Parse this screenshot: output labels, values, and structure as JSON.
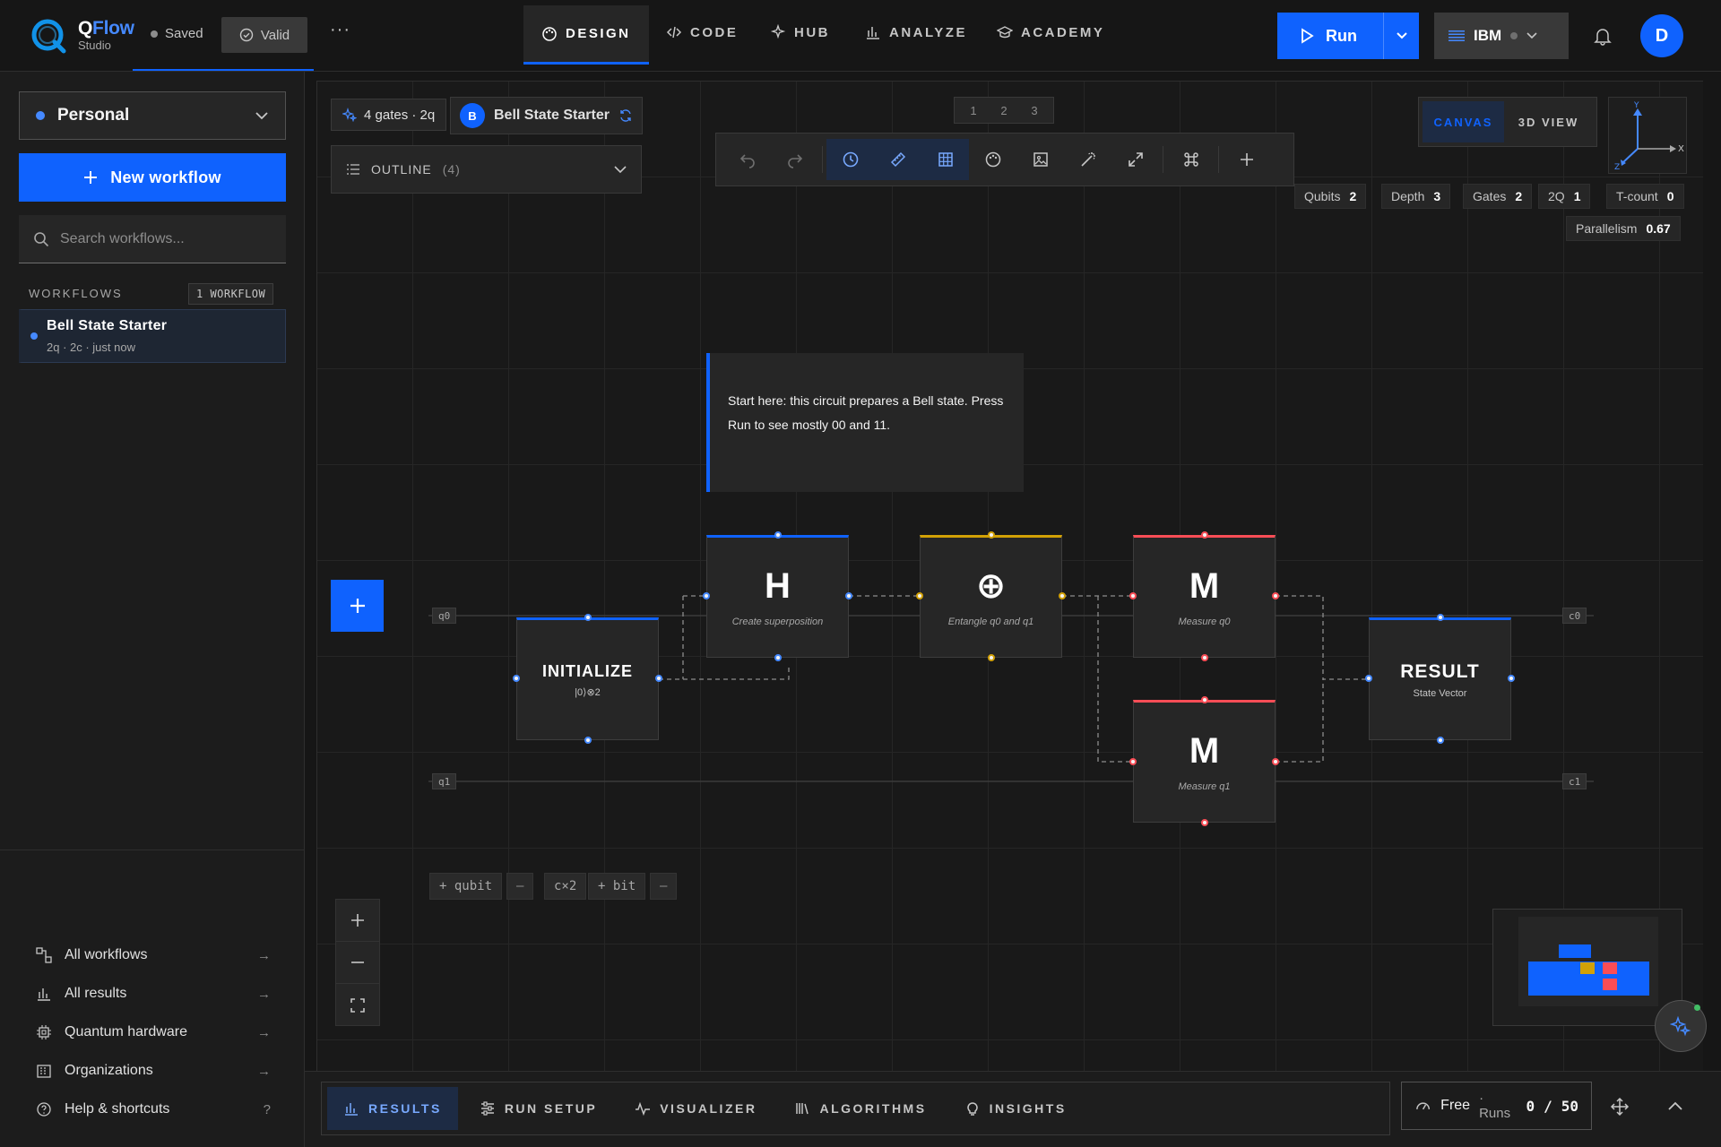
{
  "app": {
    "name_q": "Q",
    "name_rest": "Flow",
    "subtitle": "Studio",
    "saved_label": "Saved",
    "valid_label": "Valid",
    "more": "···"
  },
  "nav": [
    "DESIGN",
    "CODE",
    "HUB",
    "ANALYZE",
    "ACADEMY"
  ],
  "actions": {
    "run_label": "Run",
    "backend_label": "IBM",
    "avatar_initial": "D"
  },
  "sidebar": {
    "workspace": "Personal",
    "new_workflow": "New workflow",
    "search_placeholder": "Search workflows...",
    "workflows_heading": "WORKFLOWS",
    "workflows_count": "1 WORKFLOW",
    "workflow_item": {
      "title": "Bell State Starter",
      "meta": "2q  ·  2c  ·  just now"
    },
    "links": [
      "All workflows",
      "All results",
      "Quantum hardware",
      "Organizations",
      "Help & shortcuts"
    ],
    "help_hint": "?"
  },
  "canvas": {
    "gates_summary": "4 gates · 2q",
    "circuit_badge": "B",
    "circuit_name": "Bell State Starter",
    "outline_label": "OUTLINE",
    "outline_count": "(4)",
    "steps": [
      "1",
      "2",
      "3"
    ],
    "view_canvas": "CANVAS",
    "view_3d": "3D VIEW",
    "axis_labels": {
      "y": "Y",
      "x": "X",
      "z": "Z"
    },
    "stats": [
      {
        "label": "Qubits",
        "value": "2"
      },
      {
        "label": "Depth",
        "value": "3"
      },
      {
        "label": "Gates",
        "value": "2"
      },
      {
        "label": "2Q",
        "value": "1"
      },
      {
        "label": "T-count",
        "value": "0"
      }
    ],
    "parallelism": {
      "label": "Parallelism",
      "value": "0.67"
    },
    "note": "Start here: this circuit prepares a Bell state. Press Run to see mostly 00 and 11.",
    "wires": {
      "q0": "q0",
      "q1": "q1",
      "c0": "c0",
      "c1": "c1"
    },
    "nodes": {
      "init": {
        "title": "INITIALIZE",
        "sub": "|0⟩⊗2"
      },
      "h": {
        "symbol": "H",
        "caption": "Create superposition"
      },
      "cx": {
        "symbol": "⊕",
        "caption": "Entangle q0 and q1"
      },
      "m0": {
        "symbol": "M",
        "caption": "Measure q0"
      },
      "m1": {
        "symbol": "M",
        "caption": "Measure q1"
      },
      "result": {
        "title": "RESULT",
        "sub": "State Vector"
      }
    },
    "register_controls": {
      "add_qubit": "+ qubit",
      "minus": "—",
      "classical": "c×2",
      "add_bit": "+ bit",
      "minus2": "—"
    }
  },
  "bottom": {
    "tabs": [
      "RESULTS",
      "RUN SETUP",
      "VISUALIZER",
      "ALGORITHMS",
      "INSIGHTS"
    ],
    "plan_label": "Free",
    "runs_label": "· Runs",
    "runs_used": "0",
    "runs_sep": "/",
    "runs_total": "50"
  },
  "colors": {
    "accent": "#0f62fe",
    "h_gate": "#0f62fe",
    "cx_gate": "#d2a106",
    "measure": "#fa4d56"
  }
}
